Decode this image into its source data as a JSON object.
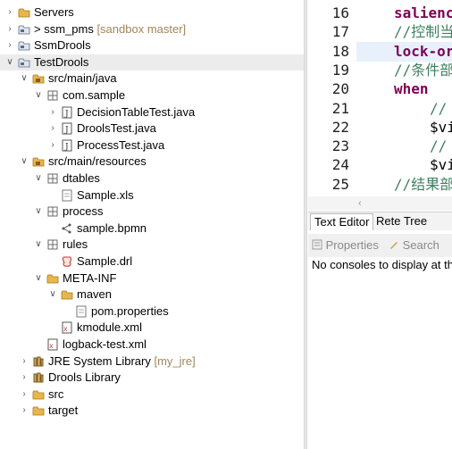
{
  "explorer": {
    "items": [
      {
        "label": "Servers",
        "decoration": "",
        "state": "collapsed",
        "icon": "folder-icon"
      },
      {
        "label": "> ssm_pms",
        "decoration": "[sandbox master]",
        "state": "collapsed",
        "icon": "project-icon"
      },
      {
        "label": "SsmDrools",
        "decoration": "",
        "state": "collapsed",
        "icon": "project-icon"
      },
      {
        "label": "TestDrools",
        "decoration": "",
        "state": "expanded",
        "icon": "project-icon"
      },
      {
        "label": "src/main/java",
        "decoration": "",
        "state": "expanded",
        "icon": "source-folder-icon"
      },
      {
        "label": "com.sample",
        "decoration": "",
        "state": "expanded",
        "icon": "package-icon"
      },
      {
        "label": "DecisionTableTest.java",
        "decoration": "",
        "state": "collapsed",
        "icon": "java-file-icon"
      },
      {
        "label": "DroolsTest.java",
        "decoration": "",
        "state": "collapsed",
        "icon": "java-file-icon"
      },
      {
        "label": "ProcessTest.java",
        "decoration": "",
        "state": "collapsed",
        "icon": "java-file-icon"
      },
      {
        "label": "src/main/resources",
        "decoration": "",
        "state": "expanded",
        "icon": "source-folder-icon"
      },
      {
        "label": "dtables",
        "decoration": "",
        "state": "expanded",
        "icon": "package-icon"
      },
      {
        "label": "Sample.xls",
        "decoration": "",
        "state": "leaf",
        "icon": "file-icon"
      },
      {
        "label": "process",
        "decoration": "",
        "state": "expanded",
        "icon": "package-icon"
      },
      {
        "label": "sample.bpmn",
        "decoration": "",
        "state": "leaf",
        "icon": "bpmn-file-icon"
      },
      {
        "label": "rules",
        "decoration": "",
        "state": "expanded",
        "icon": "package-icon"
      },
      {
        "label": "Sample.drl",
        "decoration": "",
        "state": "leaf",
        "icon": "drl-file-icon"
      },
      {
        "label": "META-INF",
        "decoration": "",
        "state": "expanded",
        "icon": "folder-icon"
      },
      {
        "label": "maven",
        "decoration": "",
        "state": "expanded",
        "icon": "folder-icon"
      },
      {
        "label": "pom.properties",
        "decoration": "",
        "state": "leaf",
        "icon": "file-icon"
      },
      {
        "label": "kmodule.xml",
        "decoration": "",
        "state": "leaf",
        "icon": "xml-file-icon"
      },
      {
        "label": "logback-test.xml",
        "decoration": "",
        "state": "leaf",
        "icon": "xml-file-icon"
      },
      {
        "label": "JRE System Library",
        "decoration": "[my_jre]",
        "state": "collapsed",
        "icon": "library-icon"
      },
      {
        "label": "Drools Library",
        "decoration": "",
        "state": "collapsed",
        "icon": "library-icon"
      },
      {
        "label": "src",
        "decoration": "",
        "state": "collapsed",
        "icon": "folder-icon"
      },
      {
        "label": "target",
        "decoration": "",
        "state": "collapsed",
        "icon": "folder-icon"
      }
    ]
  },
  "editor": {
    "lines": [
      {
        "num": "16",
        "text": "salienc",
        "style": "kw",
        "indent": 0
      },
      {
        "num": "17",
        "text": "//控制当",
        "style": "cm",
        "indent": 0
      },
      {
        "num": "18",
        "text": "lock-or",
        "style": "kw",
        "indent": 0
      },
      {
        "num": "19",
        "text": "//条件部",
        "style": "cm",
        "indent": 0
      },
      {
        "num": "20",
        "text": "when",
        "style": "kw",
        "indent": 0
      },
      {
        "num": "21",
        "text": "//",
        "style": "cm",
        "indent": 1
      },
      {
        "num": "22",
        "text": "$vi",
        "style": "tx",
        "indent": 1
      },
      {
        "num": "23",
        "text": "//",
        "style": "cm",
        "indent": 1
      },
      {
        "num": "24",
        "text": "$vi",
        "style": "tx",
        "indent": 1
      },
      {
        "num": "25",
        "text": "//结果部",
        "style": "cm",
        "indent": 0
      }
    ],
    "highlighted_line": "18"
  },
  "tabs": {
    "text_editor": "Text Editor",
    "rete_tree": "Rete Tree"
  },
  "console": {
    "properties_tab": "Properties",
    "search_tab": "Search",
    "message": "No consoles to display at th"
  }
}
